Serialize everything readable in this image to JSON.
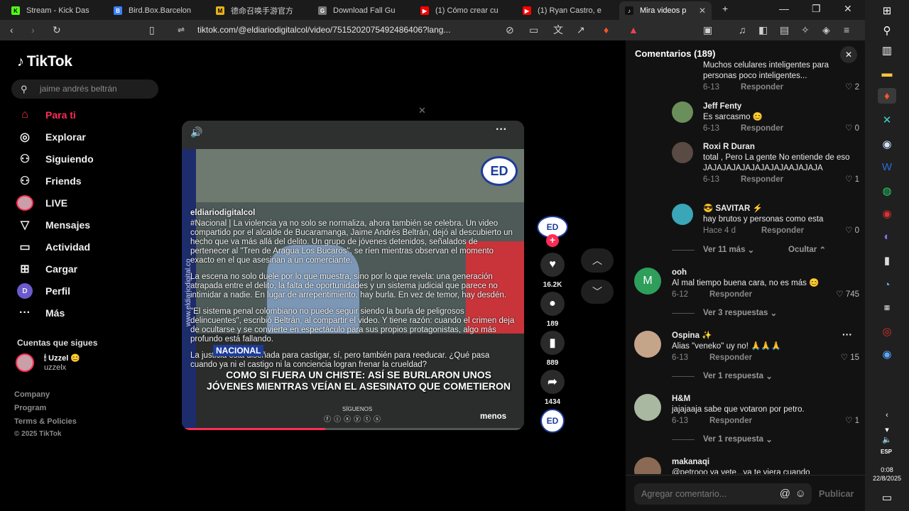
{
  "browser": {
    "tabs": [
      {
        "title": "Stream - Kick Das",
        "fav": "K",
        "color": "#53fc18"
      },
      {
        "title": "Bird.Box.Barcelon",
        "fav": "B",
        "color": "#3b82f6"
      },
      {
        "title": "德命召唤手游官方",
        "fav": "M",
        "color": "#e8b11b"
      },
      {
        "title": "Download Fall Gu",
        "fav": "G",
        "color": "#777777"
      },
      {
        "title": "(1) Cómo crear cu",
        "fav": "▶",
        "color": "#ff0000"
      },
      {
        "title": "(1) Ryan Castro, e",
        "fav": "▶",
        "color": "#ff0000"
      },
      {
        "title": "Mira videos p",
        "fav": "♪",
        "color": "#111111"
      }
    ],
    "url": "tiktok.com/@eldiariodigitalcol/video/7515202075492486406?lang..."
  },
  "sidebar": {
    "brand": "TikTok",
    "search_text": "jaime andrés beltrán",
    "nav": [
      {
        "label": "Para ti",
        "icon": "⌂"
      },
      {
        "label": "Explorar",
        "icon": "◎"
      },
      {
        "label": "Siguiendo",
        "icon": "⚇"
      },
      {
        "label": "Friends",
        "icon": "⚇"
      },
      {
        "label": "LIVE",
        "icon": "●"
      },
      {
        "label": "Mensajes",
        "icon": "▽"
      },
      {
        "label": "Actividad",
        "icon": "▭"
      },
      {
        "label": "Cargar",
        "icon": "⊞"
      },
      {
        "label": "Perfil",
        "icon": "D"
      },
      {
        "label": "Más",
        "icon": "···"
      }
    ],
    "following_heading": "Cuentas que sigues",
    "following_name": "🕯 Uzzel 😊",
    "following_handle": "uzzelx",
    "footer": [
      "Company",
      "Program",
      "Terms & Policies",
      "© 2025 TikTok"
    ]
  },
  "video": {
    "handle": "eldiariodigitalcol",
    "watermark": "www.eldiariodigital.co",
    "logo": "ED",
    "paragraphs": [
      "#Nacional | La violencia ya no solo se normaliza, ahora también se celebra. Un video compartido por el alcalde de Bucaramanga, Jaime Andrés Beltrán, dejó al descubierto un hecho que va más allá del delito. Un grupo de jóvenes detenidos, señalados de pertenecer al \"Tren de Aragua Los Bucaros\", se ríen mientras observan el momento exacto en el que asesinan a un comerciante.",
      "La escena no solo duele por lo que muestra, sino por lo que revela: una generación atrapada entre el delito, la falta de oportunidades y un sistema judicial que parece no intimidar a nadie. En lugar de arrepentimiento, hay burla. En vez de temor, hay desdén.",
      "\"El sistema penal colombiano no puede seguir siendo la burla de peligrosos delincuentes\", escribió Beltrán, al compartir el video. Y tiene razón: cuando el crimen deja de ocultarse y se convierte en espectáculo para sus propios protagonistas, algo más profundo está fallando.",
      "La justicia está diseñada para castigar, sí, pero también para reeducar. ¿Qué pasa cuando ya ni el castigo ni la conciencia logran frenar la crueldad?"
    ],
    "tag": "NACIONAL",
    "headline": "COMO SI FUERA UN CHISTE: ASÍ SE BURLARON UNOS JÓVENES MIENTRAS VEÍAN EL ASESINATO QUE COMETIERON",
    "siguenos": "SÍGUENOS",
    "less": "menos",
    "progress": 0.42
  },
  "actions": {
    "likes": "16.2K",
    "comments": "189",
    "saves": "889",
    "shares": "1434"
  },
  "comments": {
    "title": "Comentarios (189)",
    "input_placeholder": "Agregar comentario...",
    "post": "Publicar",
    "reply_label": "Responder",
    "items": [
      {
        "user": "",
        "text": "Muchos celulares inteligentes para personas poco inteligentes...",
        "date": "6-13",
        "likes": "2",
        "avatar": ""
      },
      {
        "user": "Jeff Fenty",
        "text": "Es sarcasmo 😊",
        "date": "6-13",
        "likes": "0",
        "avatar": "#6b8f5a"
      },
      {
        "user": "Roxi R Duran",
        "text": "total , Pero La gente No entiende de eso JAJAJAJAJAJAJAJAJAAJAJAJA",
        "date": "6-13",
        "likes": "1",
        "avatar": "#5a4a44"
      },
      {
        "user": "😎 SAVITAR ⚡",
        "text": "hay brutos y personas como esta",
        "date": "Hace 4 d",
        "likes": "0",
        "avatar": "#3aa6b8"
      },
      {
        "user": "ooh",
        "text": "Al mal tiempo buena cara, no es más 😊",
        "date": "6-12",
        "likes": "745",
        "avatar": "#2e9e5b",
        "initial": "M"
      },
      {
        "user": "Ospina ✨",
        "text": "Alias \"veneko\" uy no! 🙏🙏🙏",
        "date": "6-13",
        "likes": "15",
        "avatar": "#c4a58a"
      },
      {
        "user": "H&M",
        "text": "jajajaaja sabe que votaron por petro.",
        "date": "6-13",
        "likes": "1",
        "avatar": "#a9b8a0"
      },
      {
        "user": "makanaqi",
        "text": "@petrooo ya vete...ya te viera cuando",
        "date": "",
        "likes": "",
        "avatar": "#8a6a55"
      }
    ],
    "view_more": "Ver 11 más",
    "hide": "Ocultar",
    "view_3": "Ver 3 respuestas",
    "view_1a": "Ver 1 respuesta",
    "view_1b": "Ver 1 respuesta"
  },
  "system": {
    "lang": "ESP",
    "time": "0:08",
    "date": "22/8/2025"
  }
}
